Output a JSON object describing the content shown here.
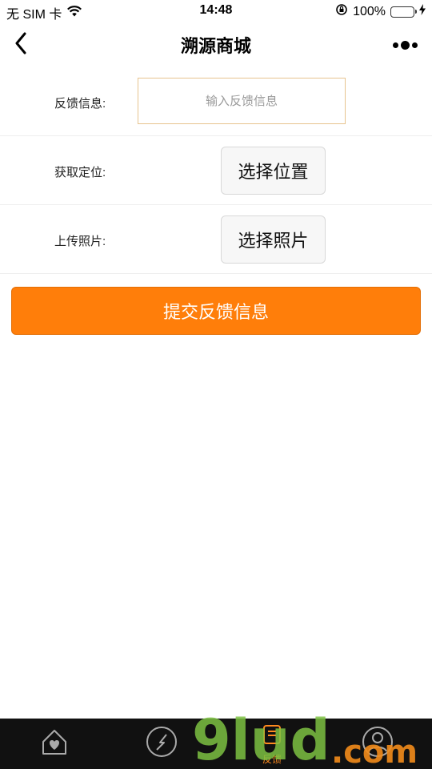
{
  "status_bar": {
    "carrier": "无 SIM 卡",
    "time": "14:48",
    "battery": "100%",
    "battery_level": 1.0
  },
  "nav": {
    "title": "溯源商城",
    "back_icon": "chevron-left-icon",
    "more_icon": "more-dots-icon"
  },
  "form": {
    "feedback_label": "反馈信息:",
    "feedback_placeholder": "输入反馈信息",
    "location_label": "获取定位:",
    "location_button": "选择位置",
    "photo_label": "上传照片:",
    "photo_button": "选择照片",
    "submit_button": "提交反馈信息"
  },
  "colors": {
    "accent": "#ff7e0a",
    "input_border": "#e7c38f",
    "tab_bar_bg": "#111111",
    "tab_active": "#ff8a1f"
  },
  "tab_bar": {
    "items": [
      {
        "icon": "home-heart-icon"
      },
      {
        "icon": "compass-icon"
      },
      {
        "icon": "feedback-icon",
        "label": "反馈"
      },
      {
        "icon": "profile-icon"
      }
    ]
  },
  "watermark": {
    "text": "9lud.com"
  }
}
